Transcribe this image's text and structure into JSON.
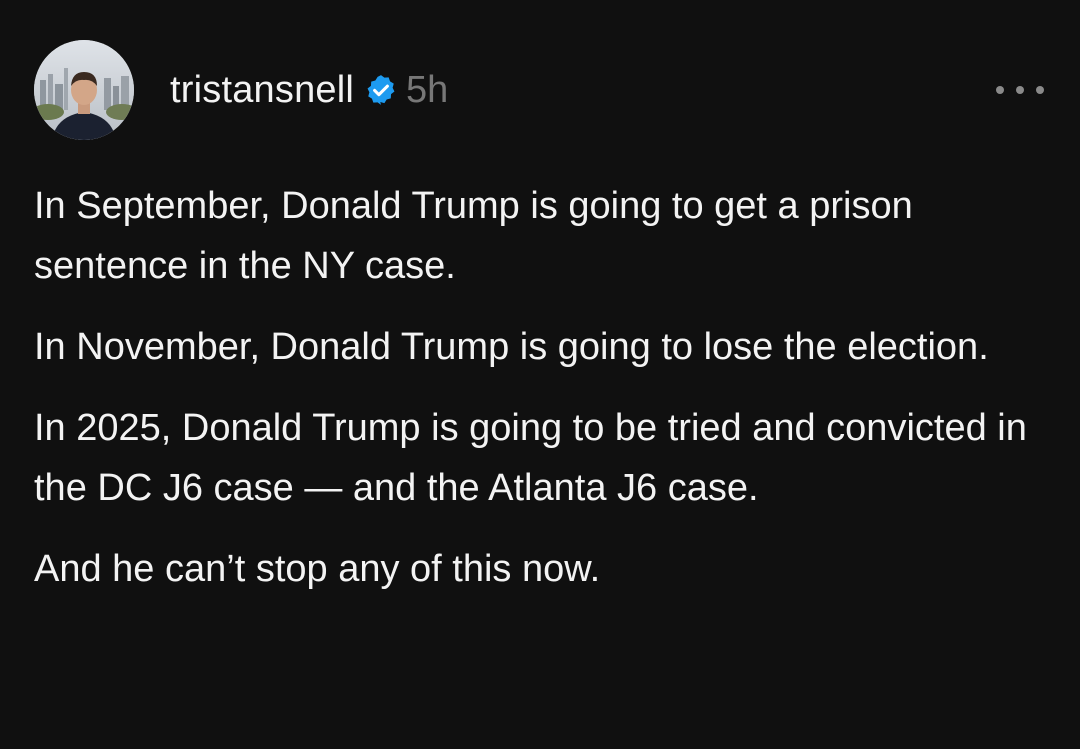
{
  "post": {
    "username": "tristansnell",
    "timestamp": "5h",
    "verified_icon": "verified-badge-icon",
    "more_icon": "more-options-icon",
    "avatar_icon": "profile-avatar",
    "colors": {
      "background": "#101010",
      "text": "#f3f3f3",
      "muted": "#777777",
      "verified": "#1d9bf0"
    },
    "paragraphs": [
      "In September, Donald Trump is going to get a prison sentence in the NY case.",
      "In November, Donald Trump is going to lose the election.",
      "In 2025, Donald Trump is going to be tried and convicted in the DC J6 case — and the Atlanta J6 case.",
      "And he can’t stop any of this now."
    ]
  }
}
